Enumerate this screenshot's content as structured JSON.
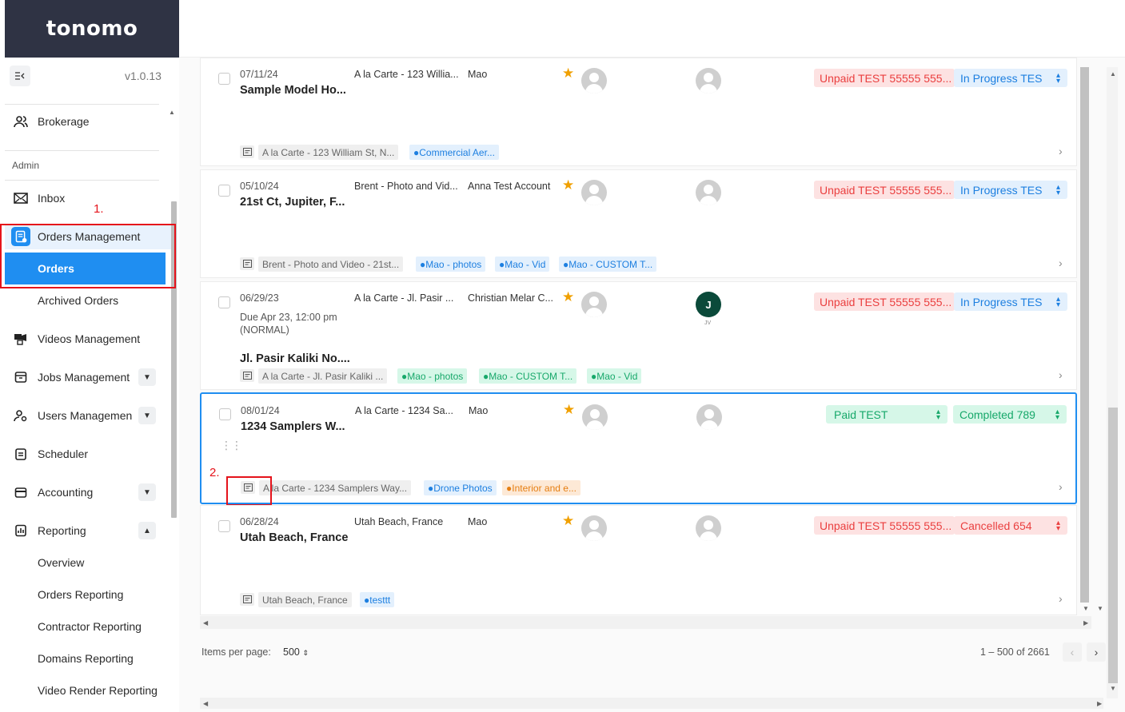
{
  "app": {
    "logo": "tonomo",
    "version": "v1.0.13"
  },
  "sidebar": {
    "brokerage": "Brokerage",
    "section_admin": "Admin",
    "items": [
      {
        "label": "Inbox"
      },
      {
        "label": "Orders Management"
      },
      {
        "label": "Videos Management"
      },
      {
        "label": "Jobs Management"
      },
      {
        "label": "Users Managemen"
      },
      {
        "label": "Scheduler"
      },
      {
        "label": "Accounting"
      },
      {
        "label": "Reporting"
      }
    ],
    "orders_sub": [
      "Orders",
      "Archived Orders"
    ],
    "reporting_sub": [
      "Overview",
      "Orders Reporting",
      "Contractor Reporting",
      "Domains Reporting",
      "Video Render Reporting"
    ]
  },
  "annotations": {
    "one": "1.",
    "two": "2."
  },
  "orders": [
    {
      "date": "07/11/24",
      "extra": [
        "",
        ""
      ],
      "title": "Sample Model Ho...",
      "service": "A la Carte - 123 Willia...",
      "client": "Mao",
      "payment": "Unpaid TEST 55555 555...",
      "status": "In Progress TES",
      "note": "A la Carte - 123 William St, N...",
      "tags": [
        {
          "label": "Commercial Aer...",
          "color": "blue"
        }
      ]
    },
    {
      "date": "05/10/24",
      "extra": [
        "",
        ""
      ],
      "title": "21st Ct, Jupiter, F...",
      "service": "Brent - Photo and Vid...",
      "client": "Anna Test Account",
      "payment": "Unpaid TEST 55555 555...",
      "status": "In Progress TES",
      "note": "Brent - Photo and Video - 21st...",
      "tags": [
        {
          "label": "Mao - photos",
          "color": "blue"
        },
        {
          "label": "Mao - Vid",
          "color": "blue"
        },
        {
          "label": "Mao - CUSTOM T...",
          "color": "blue"
        }
      ]
    },
    {
      "date": "06/29/23",
      "extra": [
        "Due Apr 23, 12:00 pm",
        "(NORMAL)"
      ],
      "title": "Jl. Pasir Kaliki No....",
      "service": "A la Carte - Jl. Pasir ...",
      "client": "Christian Melar C...",
      "assignee_initial": "J",
      "assignee_sub": "JV",
      "payment": "Unpaid TEST 55555 555...",
      "status": "In Progress TES",
      "note": "A la Carte - Jl. Pasir Kaliki ...",
      "tags": [
        {
          "label": "Mao - photos",
          "color": "green"
        },
        {
          "label": "Mao - CUSTOM T...",
          "color": "green"
        },
        {
          "label": "Mao - Vid",
          "color": "green"
        }
      ]
    },
    {
      "date": "08/01/24",
      "extra": [
        "",
        ""
      ],
      "title": "1234 Samplers W...",
      "service": "A la Carte - 1234 Sa...",
      "client": "Mao",
      "payment": "Paid TEST",
      "status": "Completed 789",
      "note": "A la Carte - 1234 Samplers Way...",
      "tags": [
        {
          "label": "Drone Photos",
          "color": "blue"
        },
        {
          "label": "Interior and e...",
          "color": "orange"
        }
      ]
    },
    {
      "date": "06/28/24",
      "extra": [
        "",
        ""
      ],
      "title": "Utah Beach, France",
      "service": "Utah Beach, France",
      "client": "Mao",
      "payment": "Unpaid TEST 55555 555...",
      "status": "Cancelled 654",
      "note": "Utah Beach, France",
      "tags": [
        {
          "label": "testtt",
          "color": "blue"
        }
      ]
    }
  ],
  "paginator": {
    "label": "Items per page:",
    "size": "500",
    "range": "1 – 500 of 2661"
  },
  "colors": {
    "accent": "#1f8ef1",
    "sidebar_header": "#2f3344",
    "annotation": "#e5131b"
  }
}
